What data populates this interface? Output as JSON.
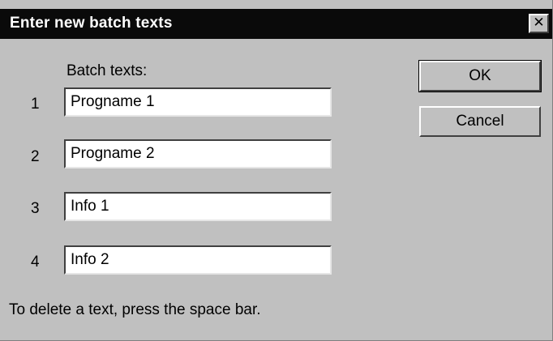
{
  "window": {
    "title": "Enter new batch texts",
    "close_glyph": "✕",
    "close_icon": "close-icon"
  },
  "form": {
    "header_label": "Batch texts:",
    "fields": [
      {
        "number": "1",
        "value": "Progname 1"
      },
      {
        "number": "2",
        "value": "Progname 2"
      },
      {
        "number": "3",
        "value": "Info 1"
      },
      {
        "number": "4",
        "value": "Info 2"
      }
    ],
    "hint": "To delete a text, press the space bar."
  },
  "buttons": {
    "ok_label": "OK",
    "cancel_label": "Cancel"
  },
  "colors": {
    "title_bar": "#0a0a0a",
    "dialog_face": "#c0c0c0"
  }
}
